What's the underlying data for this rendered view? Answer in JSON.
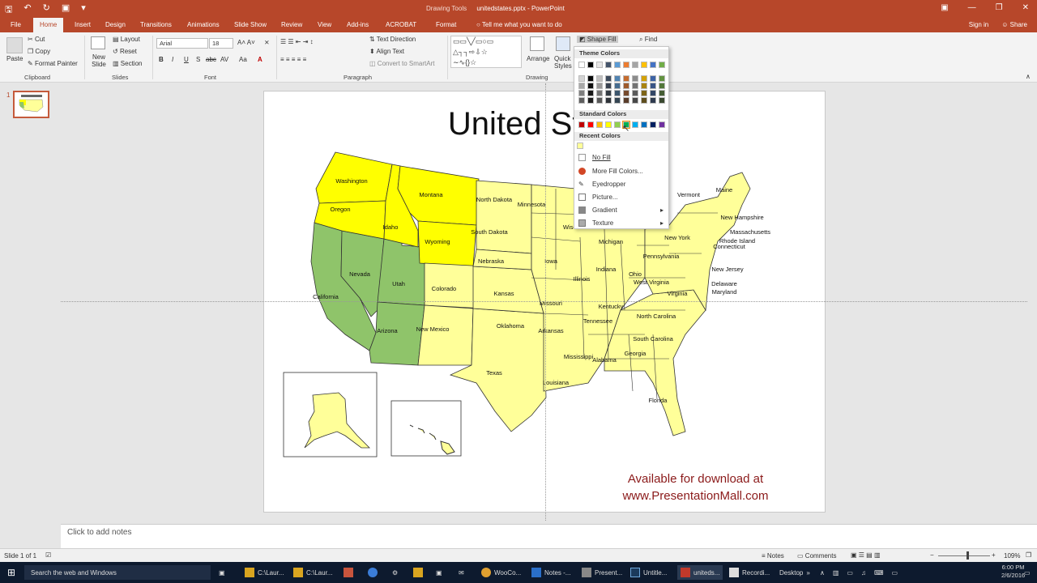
{
  "titlebar": {
    "qat_icons": [
      "save-icon",
      "undo-icon",
      "redo-icon",
      "presenter-icon"
    ],
    "context": "Drawing Tools",
    "doc_title": "unitedstates.pptx - PowerPoint"
  },
  "tabs": [
    "File",
    "Home",
    "Insert",
    "Design",
    "Transitions",
    "Animations",
    "Slide Show",
    "Review",
    "View",
    "Add-ins",
    "ACROBAT",
    "Format"
  ],
  "tell_me": "Tell me what you want to do",
  "account": {
    "signin": "Sign in",
    "share": "Share"
  },
  "ribbon": {
    "clipboard": {
      "paste": "Paste",
      "cut": "Cut",
      "copy": "Copy",
      "format_painter": "Format Painter",
      "label": "Clipboard"
    },
    "slides": {
      "new_slide": "New Slide",
      "layout": "Layout",
      "reset": "Reset",
      "section": "Section",
      "label": "Slides"
    },
    "font": {
      "name": "Arial",
      "size": "18",
      "label": "Font",
      "buttons": [
        "B",
        "I",
        "U",
        "S",
        "abc",
        "AV",
        "Aa",
        "A"
      ]
    },
    "paragraph": {
      "text_direction": "Text Direction",
      "align_text": "Align Text",
      "convert": "Convert to SmartArt",
      "label": "Paragraph"
    },
    "drawing": {
      "arrange": "Arrange",
      "quick_styles": "Quick Styles",
      "shape_fill": "Shape Fill",
      "label": "Drawing"
    },
    "editing": {
      "find": "Find"
    }
  },
  "shape_fill_menu": {
    "theme_colors": "Theme Colors",
    "standard_colors": "Standard Colors",
    "recent_colors": "Recent Colors",
    "items": [
      "No Fill",
      "More Fill Colors...",
      "Eyedropper",
      "Picture...",
      "Gradient",
      "Texture"
    ],
    "theme_palette": [
      "#ffffff",
      "#000000",
      "#e7e6e6",
      "#44546a",
      "#5b9bd5",
      "#ed7d31",
      "#a5a5a5",
      "#ffc000",
      "#4472c4",
      "#70ad47"
    ],
    "standard_palette": [
      "#c00000",
      "#ff0000",
      "#ffc000",
      "#ffff00",
      "#92d050",
      "#00b050",
      "#00b0f0",
      "#0070c0",
      "#002060",
      "#7030a0"
    ],
    "recent_palette": [
      "#ffff99"
    ]
  },
  "slide": {
    "title": "United States",
    "download_line1": "Available for download at",
    "download_line2": "www.PresentationMall.com",
    "states": [
      "Washington",
      "Oregon",
      "California",
      "Nevada",
      "Idaho",
      "Montana",
      "Wyoming",
      "Utah",
      "Arizona",
      "Colorado",
      "New Mexico",
      "North Dakota",
      "South Dakota",
      "Nebraska",
      "Kansas",
      "Oklahoma",
      "Texas",
      "Minnesota",
      "Iowa",
      "Missouri",
      "Arkansas",
      "Louisiana",
      "Wisconsin",
      "Illinois",
      "Michigan",
      "Indiana",
      "Ohio",
      "Kentucky",
      "Tennessee",
      "Mississippi",
      "Alabama",
      "Georgia",
      "Florida",
      "South Carolina",
      "North Carolina",
      "Virginia",
      "West Virginia",
      "Pennsylvania",
      "New York",
      "Vermont",
      "Maine",
      "New Hampshire",
      "Massachusetts",
      "Rhode Island",
      "Connecticut",
      "New Jersey",
      "Delaware",
      "Maryland",
      "Alaska",
      "Hawaii"
    ]
  },
  "notes_placeholder": "Click to add notes",
  "slide_number_thumb": "1",
  "status": {
    "slide_of": "Slide 1 of 1",
    "notes": "Notes",
    "comments": "Comments",
    "zoom": "109%"
  },
  "taskbar": {
    "search": "Search the web and Windows",
    "apps": [
      "C:\\Laur...",
      "C:\\Laur...",
      "WooCo...",
      "Notes -...",
      "Present...",
      "Untitle...",
      "uniteds...",
      "Recordi..."
    ],
    "desktop": "Desktop",
    "time": "6:00 PM",
    "date": "2/6/2016"
  },
  "colors": {
    "accent": "#b7472a",
    "state_yellow": "#ffff00",
    "state_light": "#ffff99",
    "state_green": "#8fc46a",
    "download_text": "#8b1a1a"
  }
}
